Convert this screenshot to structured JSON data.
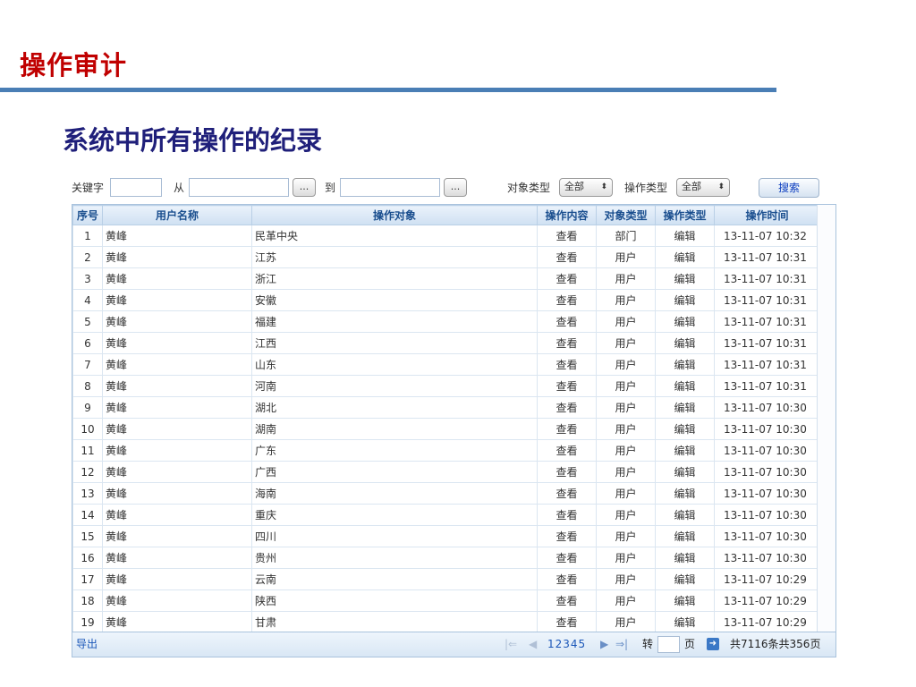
{
  "slide": {
    "title": "操作审计",
    "subtitle": "系统中所有操作的纪录"
  },
  "filters": {
    "keyword_label": "关键字",
    "keyword_value": "",
    "from_label": "从",
    "from_value": "",
    "browse_label": "...",
    "to_label": "到",
    "to_value": "",
    "object_type_label": "对象类型",
    "object_type_selected": "全部",
    "op_type_label": "操作类型",
    "op_type_selected": "全部",
    "search_label": "搜索"
  },
  "table": {
    "columns": [
      "序号",
      "用户名称",
      "操作对象",
      "操作内容",
      "对象类型",
      "操作类型",
      "操作时间"
    ],
    "rows": [
      [
        "1",
        "黄峰",
        "民革中央",
        "查看",
        "部门",
        "编辑",
        "13-11-07 10:32"
      ],
      [
        "2",
        "黄峰",
        "江苏",
        "查看",
        "用户",
        "编辑",
        "13-11-07 10:31"
      ],
      [
        "3",
        "黄峰",
        "浙江",
        "查看",
        "用户",
        "编辑",
        "13-11-07 10:31"
      ],
      [
        "4",
        "黄峰",
        "安徽",
        "查看",
        "用户",
        "编辑",
        "13-11-07 10:31"
      ],
      [
        "5",
        "黄峰",
        "福建",
        "查看",
        "用户",
        "编辑",
        "13-11-07 10:31"
      ],
      [
        "6",
        "黄峰",
        "江西",
        "查看",
        "用户",
        "编辑",
        "13-11-07 10:31"
      ],
      [
        "7",
        "黄峰",
        "山东",
        "查看",
        "用户",
        "编辑",
        "13-11-07 10:31"
      ],
      [
        "8",
        "黄峰",
        "河南",
        "查看",
        "用户",
        "编辑",
        "13-11-07 10:31"
      ],
      [
        "9",
        "黄峰",
        "湖北",
        "查看",
        "用户",
        "编辑",
        "13-11-07 10:30"
      ],
      [
        "10",
        "黄峰",
        "湖南",
        "查看",
        "用户",
        "编辑",
        "13-11-07 10:30"
      ],
      [
        "11",
        "黄峰",
        "广东",
        "查看",
        "用户",
        "编辑",
        "13-11-07 10:30"
      ],
      [
        "12",
        "黄峰",
        "广西",
        "查看",
        "用户",
        "编辑",
        "13-11-07 10:30"
      ],
      [
        "13",
        "黄峰",
        "海南",
        "查看",
        "用户",
        "编辑",
        "13-11-07 10:30"
      ],
      [
        "14",
        "黄峰",
        "重庆",
        "查看",
        "用户",
        "编辑",
        "13-11-07 10:30"
      ],
      [
        "15",
        "黄峰",
        "四川",
        "查看",
        "用户",
        "编辑",
        "13-11-07 10:30"
      ],
      [
        "16",
        "黄峰",
        "贵州",
        "查看",
        "用户",
        "编辑",
        "13-11-07 10:30"
      ],
      [
        "17",
        "黄峰",
        "云南",
        "查看",
        "用户",
        "编辑",
        "13-11-07 10:29"
      ],
      [
        "18",
        "黄峰",
        "陕西",
        "查看",
        "用户",
        "编辑",
        "13-11-07 10:29"
      ],
      [
        "19",
        "黄峰",
        "甘肃",
        "查看",
        "用户",
        "编辑",
        "13-11-07 10:29"
      ]
    ]
  },
  "footer": {
    "export_label": "导出",
    "pages": "12345",
    "goto_label": "转",
    "goto_value": "",
    "page_unit": "页",
    "summary": "共7116条共356页"
  },
  "icons": {
    "first": "first-page-icon",
    "prev": "prev-page-icon",
    "next": "next-page-icon",
    "last": "last-page-icon",
    "go": "go-arrow-icon"
  },
  "colors": {
    "title": "#c00000",
    "rule": "#4a7eb5",
    "subtitle": "#1f1f7a",
    "header_text": "#1b4f8f",
    "link": "#1a56b8"
  }
}
